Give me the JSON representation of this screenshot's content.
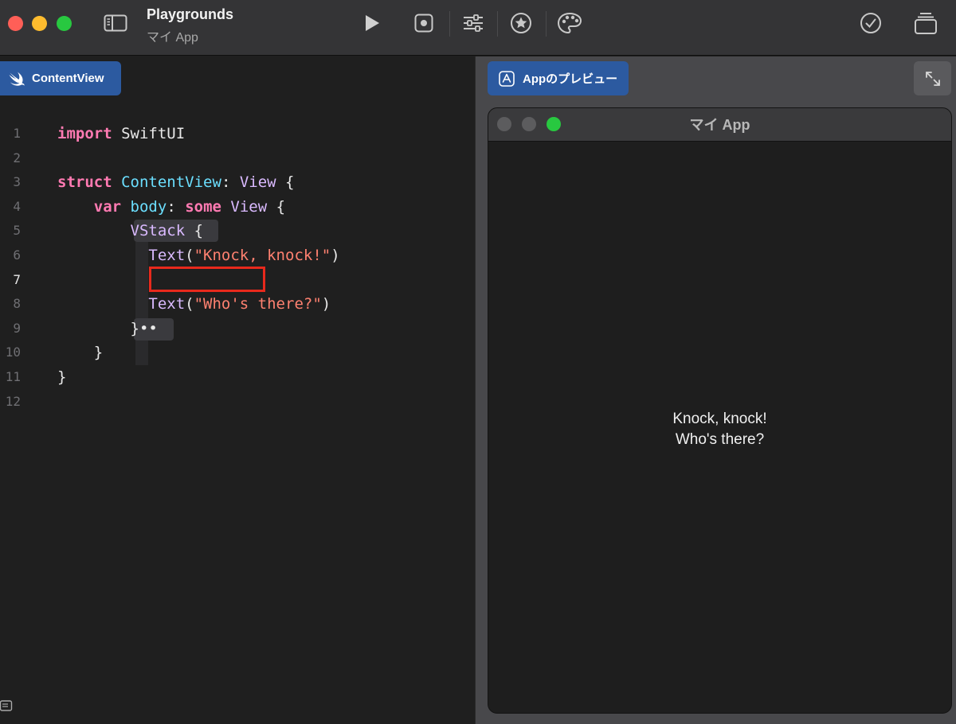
{
  "window": {
    "title": "Playgrounds",
    "subtitle": "マイ App"
  },
  "toolbar": {
    "icons": [
      "sidebar-icon",
      "play-icon",
      "record-icon",
      "sliders-icon",
      "star-icon",
      "palette-icon",
      "checkmark-icon",
      "stack-icon"
    ]
  },
  "editor": {
    "tab_label": "ContentView",
    "lines": [
      {
        "n": "1",
        "tokens": [
          {
            "t": "import",
            "c": "kw"
          },
          {
            "t": " SwiftUI",
            "c": "plain"
          }
        ]
      },
      {
        "n": "2",
        "tokens": []
      },
      {
        "n": "3",
        "tokens": [
          {
            "t": "struct",
            "c": "kw"
          },
          {
            "t": " ",
            "c": "plain"
          },
          {
            "t": "ContentView",
            "c": "decl"
          },
          {
            "t": ": ",
            "c": "plain"
          },
          {
            "t": "View",
            "c": "type"
          },
          {
            "t": " {",
            "c": "plain"
          }
        ]
      },
      {
        "n": "4",
        "tokens": [
          {
            "t": "    ",
            "c": "plain"
          },
          {
            "t": "var",
            "c": "kw"
          },
          {
            "t": " ",
            "c": "plain"
          },
          {
            "t": "body",
            "c": "decl"
          },
          {
            "t": ": ",
            "c": "plain"
          },
          {
            "t": "some",
            "c": "kw"
          },
          {
            "t": " ",
            "c": "plain"
          },
          {
            "t": "View",
            "c": "type"
          },
          {
            "t": " {",
            "c": "plain"
          }
        ]
      },
      {
        "n": "5",
        "tokens": [
          {
            "t": "        ",
            "c": "plain"
          },
          {
            "t": "VStack",
            "c": "type"
          },
          {
            "t": " {",
            "c": "plain"
          }
        ]
      },
      {
        "n": "6",
        "tokens": [
          {
            "t": "          ",
            "c": "plain"
          },
          {
            "t": "Text",
            "c": "type"
          },
          {
            "t": "(",
            "c": "plain"
          },
          {
            "t": "\"Knock, knock!\"",
            "c": "str"
          },
          {
            "t": ")",
            "c": "plain"
          }
        ]
      },
      {
        "n": "7",
        "tokens": []
      },
      {
        "n": "8",
        "tokens": [
          {
            "t": "          ",
            "c": "plain"
          },
          {
            "t": "Text",
            "c": "type"
          },
          {
            "t": "(",
            "c": "plain"
          },
          {
            "t": "\"Who's there?\"",
            "c": "str"
          },
          {
            "t": ")",
            "c": "plain"
          }
        ]
      },
      {
        "n": "9",
        "tokens": [
          {
            "t": "        }",
            "c": "plain"
          },
          {
            "t": "••",
            "c": "plain"
          }
        ]
      },
      {
        "n": "10",
        "tokens": [
          {
            "t": "    }",
            "c": "plain"
          }
        ]
      },
      {
        "n": "11",
        "tokens": [
          {
            "t": "}",
            "c": "plain"
          }
        ]
      },
      {
        "n": "12",
        "tokens": []
      }
    ],
    "active_line": "7"
  },
  "preview": {
    "tab_label": "Appのプレビュー",
    "window_title": "マイ App",
    "content_lines": [
      "Knock, knock!",
      "Who's there?"
    ]
  },
  "colors": {
    "keyword": "#ff7ab2",
    "type": "#dabaff",
    "declaration": "#6bdfff",
    "string": "#ff8170",
    "accent": "#2c5aa0",
    "highlight_box": "#e8291c"
  }
}
